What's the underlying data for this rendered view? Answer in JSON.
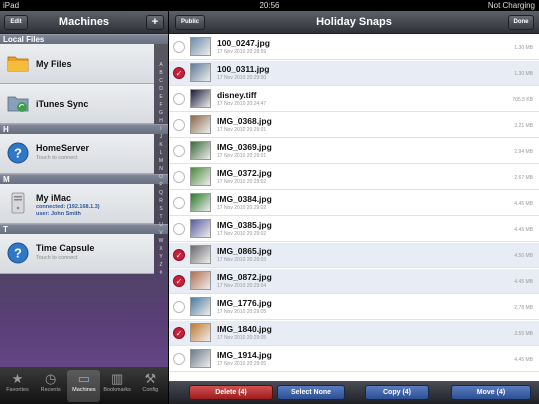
{
  "status": {
    "carrier": "iPad",
    "time": "20:56",
    "battery": "Not Charging"
  },
  "left": {
    "title": "Machines",
    "edit": "Edit",
    "add": "+",
    "sections": [
      {
        "header": "Local Files",
        "items": [
          {
            "name": "My Files",
            "icon": "folder-icon"
          },
          {
            "name": "iTunes Sync",
            "icon": "itunes-sync-icon"
          }
        ]
      },
      {
        "header": "H",
        "items": [
          {
            "name": "HomeServer",
            "sub": "Touch to connect",
            "icon": "question-icon"
          }
        ]
      },
      {
        "header": "M",
        "items": [
          {
            "name": "My iMac",
            "line1": "connected: (192.168.1.3)",
            "line2": "user: John Smith",
            "icon": "imac-icon"
          }
        ]
      },
      {
        "header": "T",
        "items": [
          {
            "name": "Time Capsule",
            "sub": "Touch to connect",
            "icon": "question-icon"
          }
        ]
      }
    ],
    "index": [
      "A",
      "B",
      "C",
      "D",
      "E",
      "F",
      "G",
      "H",
      "I",
      "J",
      "K",
      "L",
      "M",
      "N",
      "O",
      "P",
      "Q",
      "R",
      "S",
      "T",
      "U",
      "V",
      "W",
      "X",
      "Y",
      "Z",
      "#"
    ]
  },
  "tabs": [
    {
      "label": "Favorites",
      "glyph": "★"
    },
    {
      "label": "Recents",
      "glyph": "◷"
    },
    {
      "label": "Machines",
      "glyph": "▭"
    },
    {
      "label": "Bookmarks",
      "glyph": "▥"
    },
    {
      "label": "Config",
      "glyph": "⚒"
    }
  ],
  "right": {
    "title": "Holiday Snaps",
    "public": "Public",
    "done": "Done",
    "files": [
      {
        "name": "100_0247.jpg",
        "date": "17 Nov 2010 20:28:59",
        "size": "1.30 MB",
        "checked": false,
        "thumb": "#6a8caa"
      },
      {
        "name": "100_0311.jpg",
        "date": "17 Nov 2010 20:29:00",
        "size": "1.30 MB",
        "checked": true,
        "thumb": "#5d7a96"
      },
      {
        "name": "disney.tiff",
        "date": "17 Nov 2010 20:24:47",
        "size": "705.5 KB",
        "checked": false,
        "thumb": "#1a1a3a"
      },
      {
        "name": "IMG_0368.jpg",
        "date": "17 Nov 2010 20:29:01",
        "size": "3.21 MB",
        "checked": false,
        "thumb": "#8a6a4a"
      },
      {
        "name": "IMG_0369.jpg",
        "date": "17 Nov 2010 20:29:01",
        "size": "2.94 MB",
        "checked": false,
        "thumb": "#3a6a3a"
      },
      {
        "name": "IMG_0372.jpg",
        "date": "17 Nov 2010 20:29:02",
        "size": "2.67 MB",
        "checked": false,
        "thumb": "#4a8a3a"
      },
      {
        "name": "IMG_0384.jpg",
        "date": "17 Nov 2010 20:29:02",
        "size": "4.45 MB",
        "checked": false,
        "thumb": "#2a7a2a"
      },
      {
        "name": "IMG_0385.jpg",
        "date": "17 Nov 2010 20:29:02",
        "size": "4.45 MB",
        "checked": false,
        "thumb": "#5a5aa0"
      },
      {
        "name": "IMG_0865.jpg",
        "date": "17 Nov 2010 20:29:03",
        "size": "4.50 MB",
        "checked": true,
        "thumb": "#6a6a6a"
      },
      {
        "name": "IMG_0872.jpg",
        "date": "17 Nov 2010 20:29:04",
        "size": "4.45 MB",
        "checked": true,
        "thumb": "#b07050"
      },
      {
        "name": "IMG_1776.jpg",
        "date": "17 Nov 2010 20:29:05",
        "size": "2.78 MB",
        "checked": false,
        "thumb": "#4a7aa0"
      },
      {
        "name": "IMG_1840.jpg",
        "date": "17 Nov 2010 20:29:05",
        "size": "3.55 MB",
        "checked": true,
        "thumb": "#c07a30"
      },
      {
        "name": "IMG_1914.jpg",
        "date": "17 Nov 2010 20:29:05",
        "size": "4.45 MB",
        "checked": false,
        "thumb": "#6a7a8a"
      }
    ],
    "actions": {
      "delete": "Delete (4)",
      "select_none": "Select None",
      "copy": "Copy (4)",
      "move": "Move (4)"
    }
  }
}
